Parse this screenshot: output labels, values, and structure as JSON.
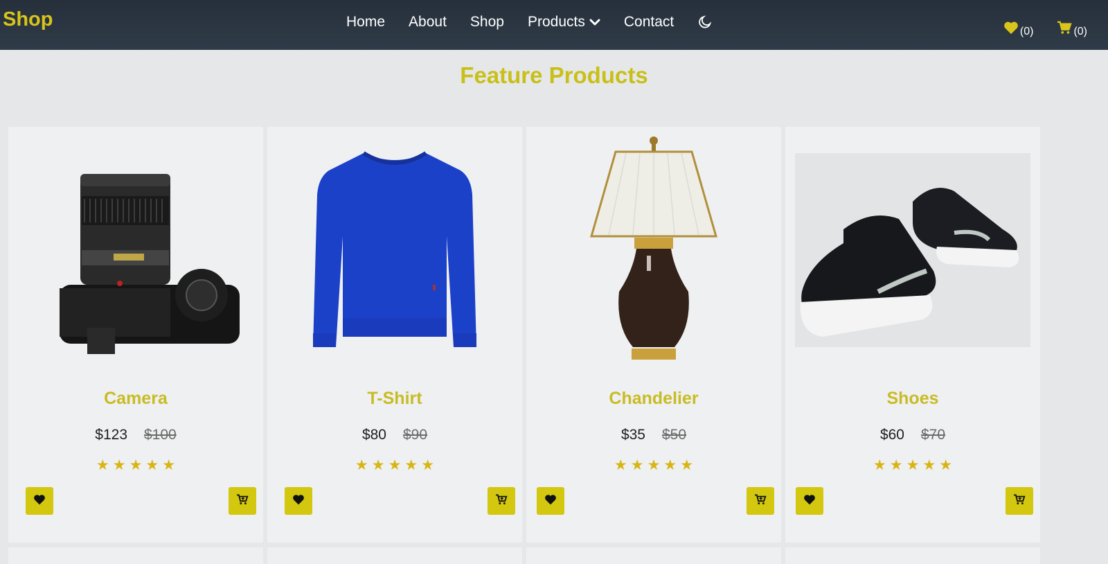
{
  "brand": "Shop",
  "nav": {
    "items": [
      {
        "label": "Home"
      },
      {
        "label": "About"
      },
      {
        "label": "Shop"
      },
      {
        "label": "Products"
      },
      {
        "label": "Contact"
      }
    ],
    "dark_mode_icon": "moon-icon"
  },
  "counters": {
    "wishlist": "(0)",
    "cart": "(0)"
  },
  "section": {
    "title": "Feature Products"
  },
  "products": [
    {
      "name": "Camera",
      "price": "$123",
      "old_price": "$100",
      "rating": 5,
      "image": "camera-image"
    },
    {
      "name": "T-Shirt",
      "price": "$80",
      "old_price": "$90",
      "rating": 5,
      "image": "sweater-image"
    },
    {
      "name": "Chandelier",
      "price": "$35",
      "old_price": "$50",
      "rating": 5,
      "image": "lamp-image"
    },
    {
      "name": "Shoes",
      "price": "$60",
      "old_price": "$70",
      "rating": 5,
      "image": "shoes-image"
    }
  ],
  "colors": {
    "accent": "#d3c70f",
    "title": "#c8c019",
    "nav_bg": "#2b3542",
    "star": "#d8b514"
  }
}
